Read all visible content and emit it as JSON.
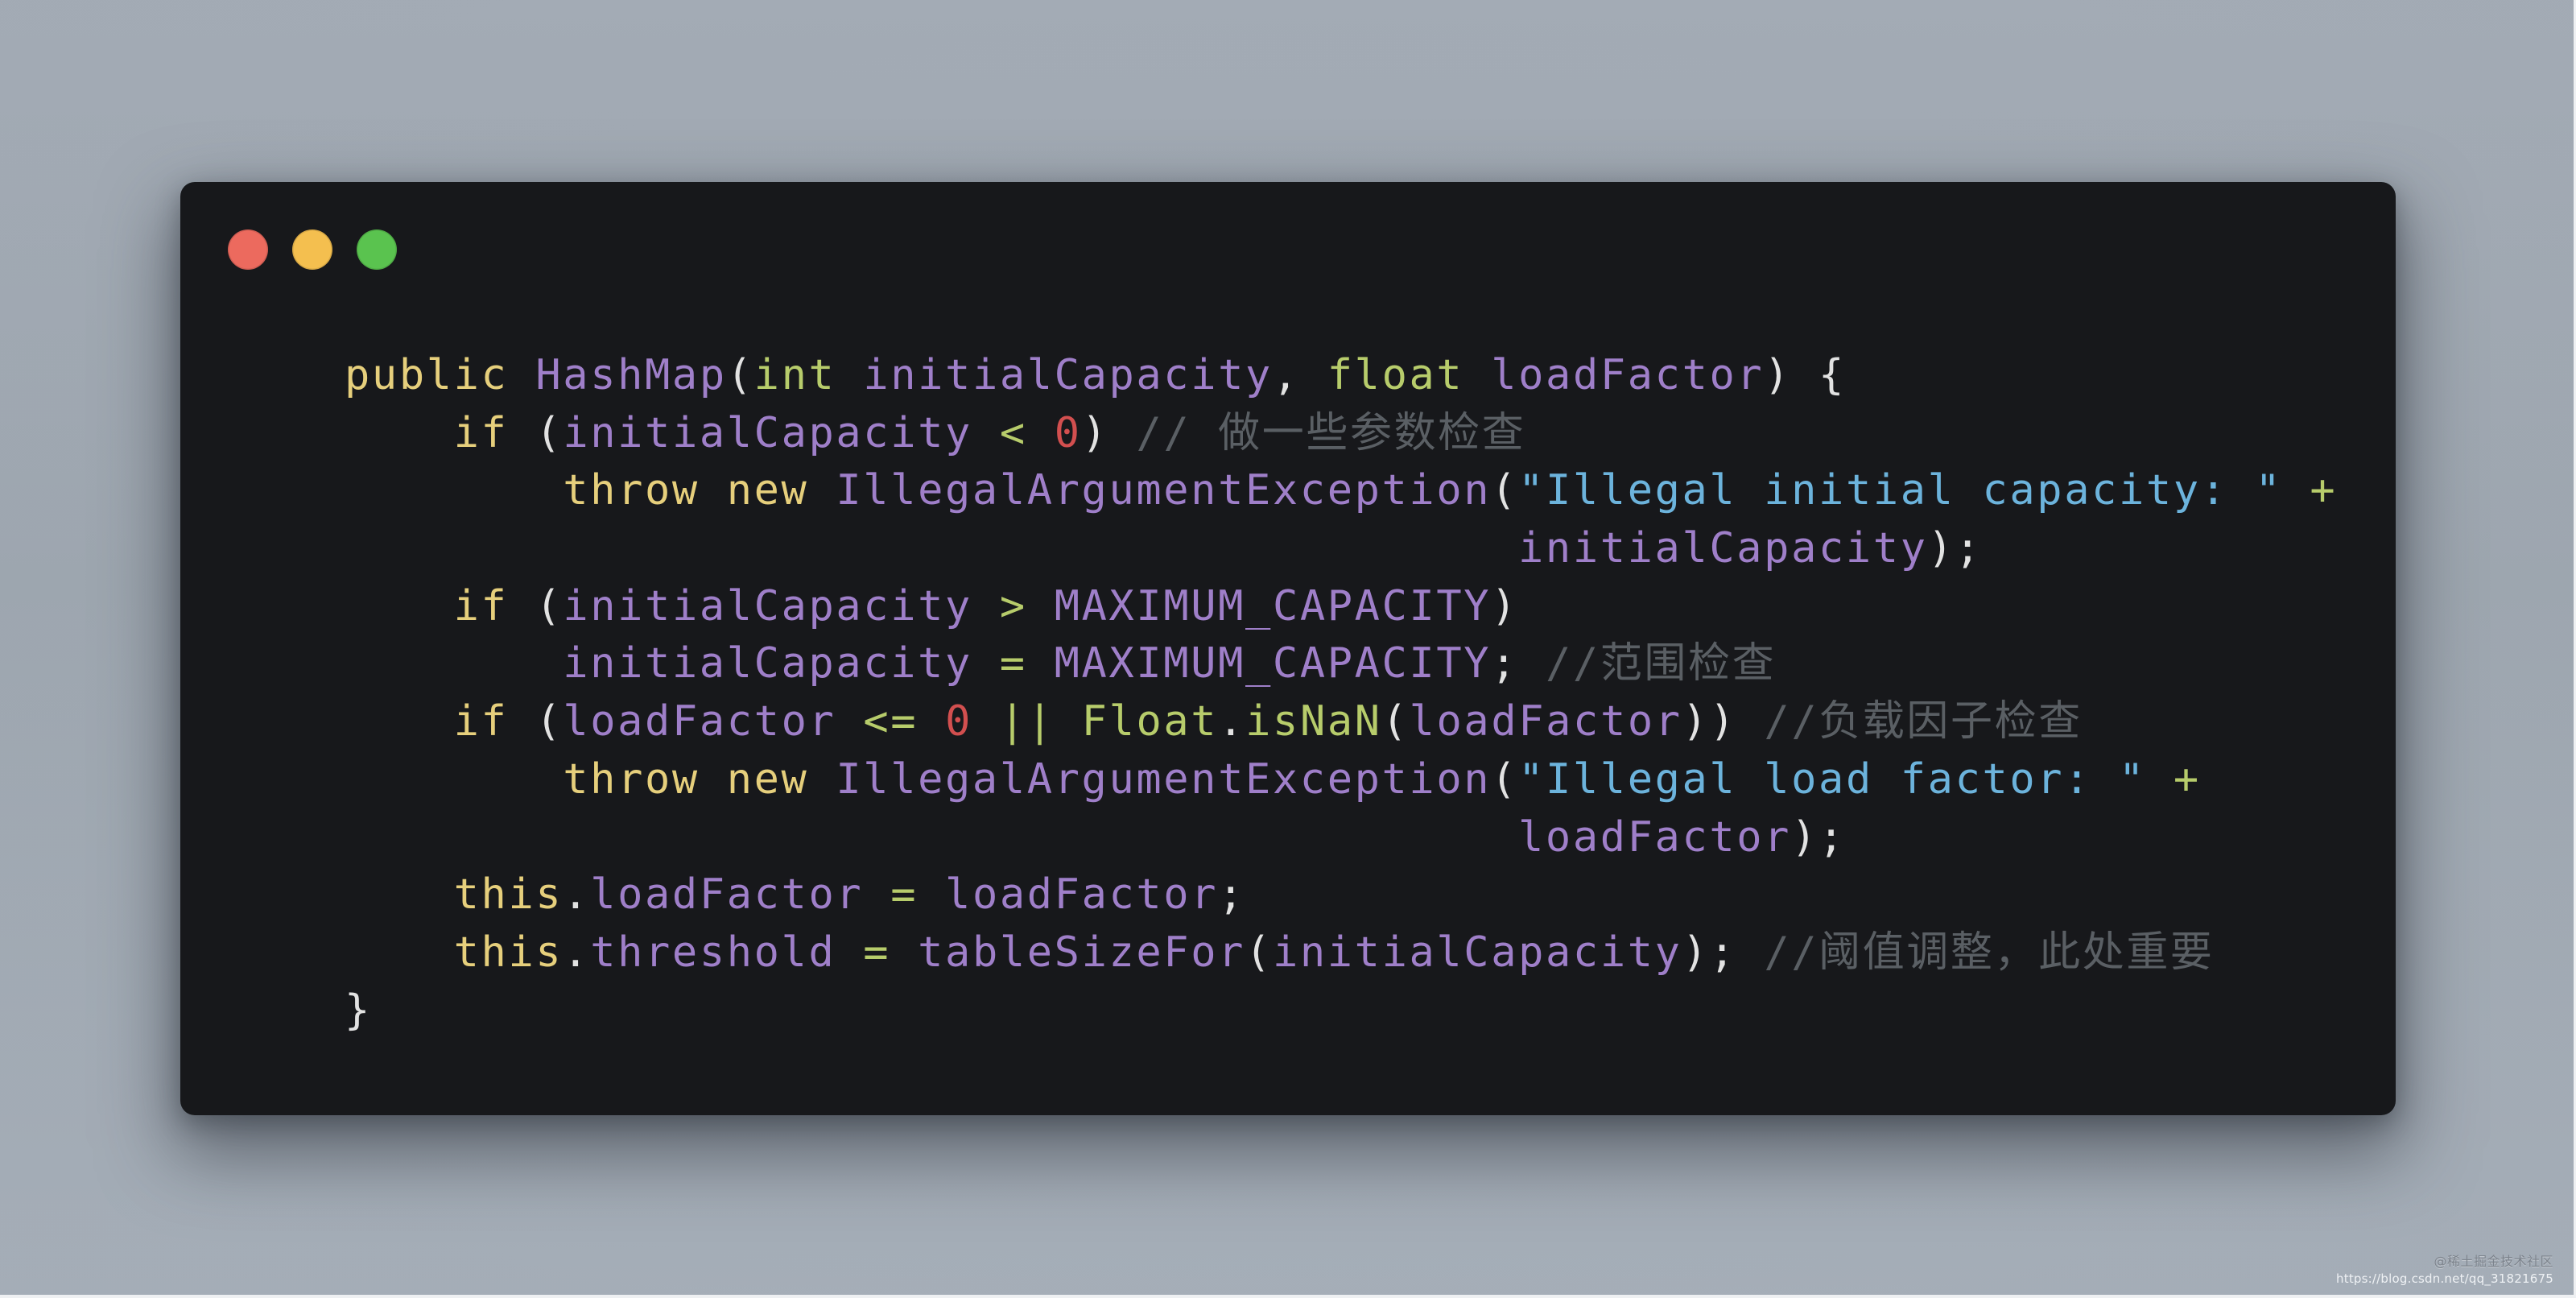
{
  "window": {
    "traffic_lights": [
      {
        "name": "close",
        "color": "#ec6a5e"
      },
      {
        "name": "minimize",
        "color": "#f4bf4f"
      },
      {
        "name": "maximize",
        "color": "#5ac34f"
      }
    ]
  },
  "code": {
    "language": "java",
    "lines": [
      [
        [
          "kw",
          "public"
        ],
        [
          "ws",
          " "
        ],
        [
          "id",
          "HashMap"
        ],
        [
          "punc",
          "("
        ],
        [
          "type",
          "int"
        ],
        [
          "ws",
          " "
        ],
        [
          "id",
          "initialCapacity"
        ],
        [
          "punc",
          ","
        ],
        [
          "ws",
          " "
        ],
        [
          "type",
          "float"
        ],
        [
          "ws",
          " "
        ],
        [
          "id",
          "loadFactor"
        ],
        [
          "punc",
          ")"
        ],
        [
          "ws",
          " "
        ],
        [
          "punc",
          "{"
        ]
      ],
      [
        [
          "ws",
          "    "
        ],
        [
          "kw",
          "if"
        ],
        [
          "ws",
          " "
        ],
        [
          "punc",
          "("
        ],
        [
          "id",
          "initialCapacity"
        ],
        [
          "ws",
          " "
        ],
        [
          "op",
          "<"
        ],
        [
          "ws",
          " "
        ],
        [
          "num",
          "0"
        ],
        [
          "punc",
          ")"
        ],
        [
          "ws",
          " "
        ],
        [
          "com",
          "// 做一些参数检查"
        ]
      ],
      [
        [
          "ws",
          "        "
        ],
        [
          "kw",
          "throw"
        ],
        [
          "ws",
          " "
        ],
        [
          "kw",
          "new"
        ],
        [
          "ws",
          " "
        ],
        [
          "id",
          "IllegalArgumentException"
        ],
        [
          "punc",
          "("
        ],
        [
          "str",
          "\"Illegal initial capacity: \""
        ],
        [
          "ws",
          " "
        ],
        [
          "op",
          "+"
        ]
      ],
      [
        [
          "ws",
          "                                           "
        ],
        [
          "id",
          "initialCapacity"
        ],
        [
          "punc",
          ");"
        ]
      ],
      [
        [
          "ws",
          "    "
        ],
        [
          "kw",
          "if"
        ],
        [
          "ws",
          " "
        ],
        [
          "punc",
          "("
        ],
        [
          "id",
          "initialCapacity"
        ],
        [
          "ws",
          " "
        ],
        [
          "op",
          ">"
        ],
        [
          "ws",
          " "
        ],
        [
          "id",
          "MAXIMUM_CAPACITY"
        ],
        [
          "punc",
          ")"
        ]
      ],
      [
        [
          "ws",
          "        "
        ],
        [
          "id",
          "initialCapacity"
        ],
        [
          "ws",
          " "
        ],
        [
          "op",
          "="
        ],
        [
          "ws",
          " "
        ],
        [
          "id",
          "MAXIMUM_CAPACITY"
        ],
        [
          "punc",
          ";"
        ],
        [
          "ws",
          " "
        ],
        [
          "com",
          "//范围检查"
        ]
      ],
      [
        [
          "ws",
          "    "
        ],
        [
          "kw",
          "if"
        ],
        [
          "ws",
          " "
        ],
        [
          "punc",
          "("
        ],
        [
          "id",
          "loadFactor"
        ],
        [
          "ws",
          " "
        ],
        [
          "op",
          "<="
        ],
        [
          "ws",
          " "
        ],
        [
          "num",
          "0"
        ],
        [
          "ws",
          " "
        ],
        [
          "op",
          "||"
        ],
        [
          "ws",
          " "
        ],
        [
          "type",
          "Float"
        ],
        [
          "punc",
          "."
        ],
        [
          "type",
          "isNaN"
        ],
        [
          "punc",
          "("
        ],
        [
          "id",
          "loadFactor"
        ],
        [
          "punc",
          "))"
        ],
        [
          "ws",
          " "
        ],
        [
          "com",
          "//负载因子检查"
        ]
      ],
      [
        [
          "ws",
          "        "
        ],
        [
          "kw",
          "throw"
        ],
        [
          "ws",
          " "
        ],
        [
          "kw",
          "new"
        ],
        [
          "ws",
          " "
        ],
        [
          "id",
          "IllegalArgumentException"
        ],
        [
          "punc",
          "("
        ],
        [
          "str",
          "\"Illegal load factor: \""
        ],
        [
          "ws",
          " "
        ],
        [
          "op",
          "+"
        ]
      ],
      [
        [
          "ws",
          "                                           "
        ],
        [
          "id",
          "loadFactor"
        ],
        [
          "punc",
          ");"
        ]
      ],
      [
        [
          "ws",
          "    "
        ],
        [
          "kw",
          "this"
        ],
        [
          "punc",
          "."
        ],
        [
          "id",
          "loadFactor"
        ],
        [
          "ws",
          " "
        ],
        [
          "op",
          "="
        ],
        [
          "ws",
          " "
        ],
        [
          "id",
          "loadFactor"
        ],
        [
          "punc",
          ";"
        ]
      ],
      [
        [
          "ws",
          "    "
        ],
        [
          "kw",
          "this"
        ],
        [
          "punc",
          "."
        ],
        [
          "id",
          "threshold"
        ],
        [
          "ws",
          " "
        ],
        [
          "op",
          "="
        ],
        [
          "ws",
          " "
        ],
        [
          "id",
          "tableSizeFor"
        ],
        [
          "punc",
          "("
        ],
        [
          "id",
          "initialCapacity"
        ],
        [
          "punc",
          ");"
        ],
        [
          "ws",
          " "
        ],
        [
          "com",
          "//阈值调整，此处重要"
        ]
      ],
      [
        [
          "punc",
          "}"
        ]
      ]
    ]
  },
  "watermark": {
    "line1": "@稀土掘金技术社区",
    "line2": "https://blog.csdn.net/qq_31821675"
  }
}
